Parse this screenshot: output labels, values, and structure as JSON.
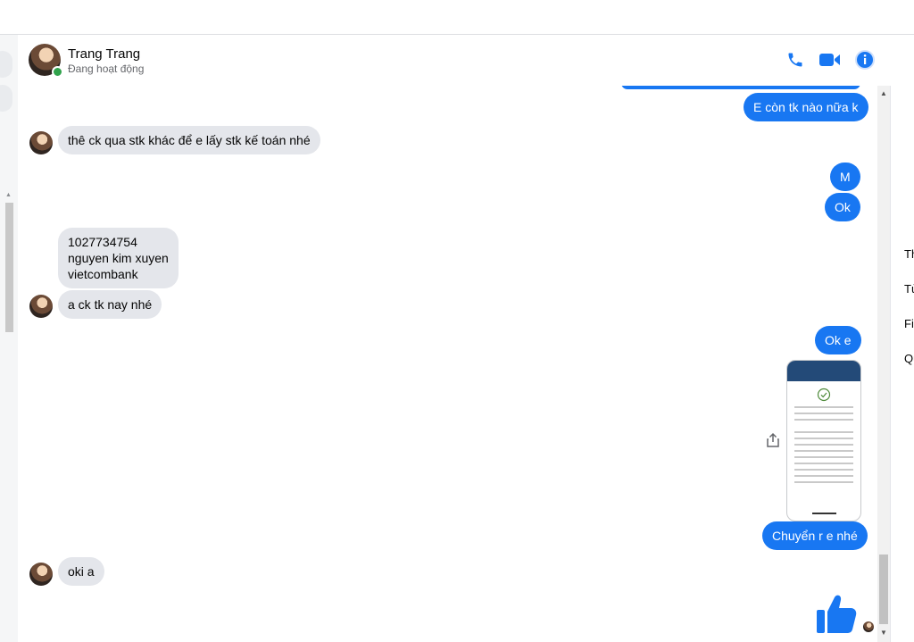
{
  "header": {
    "name": "Trang Trang",
    "status": "Đang hoạt động",
    "icons": [
      "phone-icon",
      "video-icon",
      "info-icon"
    ],
    "accent": "#1877f2"
  },
  "messages": {
    "m0": "E còn tk nào nữa k",
    "m1": "thê ck qua stk khác để e lấy stk kế toán nhé",
    "m2": "M",
    "m3": "Ok",
    "m4": "1027734754\nnguyen kim xuyen\nvietcombank",
    "m5": "a ck tk nay nhé",
    "m6": "Ok e",
    "m7": "Chuyển r e nhé",
    "m8": "oki a"
  },
  "right_panel": {
    "items": [
      "Th",
      "Tù",
      "Fil",
      "Qu"
    ]
  },
  "colors": {
    "outgoing": "#1877f2",
    "incoming": "#e4e6eb",
    "online": "#31a24c"
  }
}
